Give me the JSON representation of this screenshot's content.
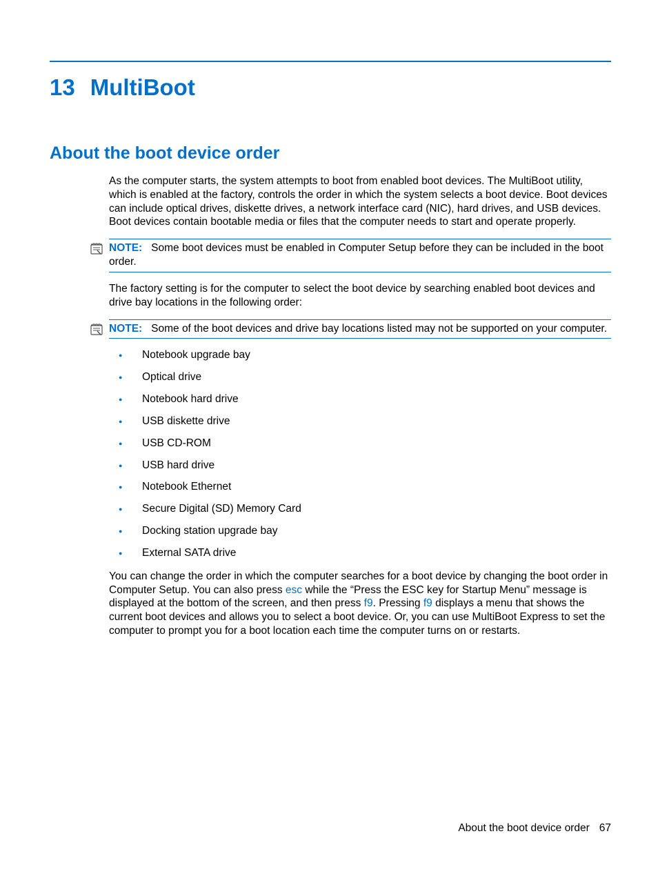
{
  "chapter": {
    "number": "13",
    "title": "MultiBoot"
  },
  "section": {
    "title": "About the boot device order"
  },
  "para1": "As the computer starts, the system attempts to boot from enabled boot devices. The MultiBoot utility, which is enabled at the factory, controls the order in which the system selects a boot device. Boot devices can include optical drives, diskette drives, a network interface card (NIC), hard drives, and USB devices. Boot devices contain bootable media or files that the computer needs to start and operate properly.",
  "note1": {
    "label": "NOTE:",
    "text": "Some boot devices must be enabled in Computer Setup before they can be included in the boot order."
  },
  "para2": "The factory setting is for the computer to select the boot device by searching enabled boot devices and drive bay locations in the following order:",
  "note2": {
    "label": "NOTE:",
    "text": "Some of the boot devices and drive bay locations listed may not be supported on your computer."
  },
  "boot_list": [
    "Notebook upgrade bay",
    "Optical drive",
    "Notebook hard drive",
    "USB diskette drive",
    "USB CD-ROM",
    "USB hard drive",
    "Notebook Ethernet",
    "Secure Digital (SD) Memory Card",
    "Docking station upgrade bay",
    "External SATA drive"
  ],
  "para3": {
    "t1": "You can change the order in which the computer searches for a boot device by changing the boot order in Computer Setup. You can also press ",
    "k1": "esc",
    "t2": " while the “Press the ESC key for Startup Menu” message is displayed at the bottom of the screen, and then press ",
    "k2": "f9",
    "t3": ". Pressing ",
    "k3": "f9",
    "t4": " displays a menu that shows the current boot devices and allows you to select a boot device. Or, you can use MultiBoot Express to set the computer to prompt you for a boot location each time the computer turns on or restarts."
  },
  "footer": {
    "text": "About the boot device order",
    "page": "67"
  }
}
